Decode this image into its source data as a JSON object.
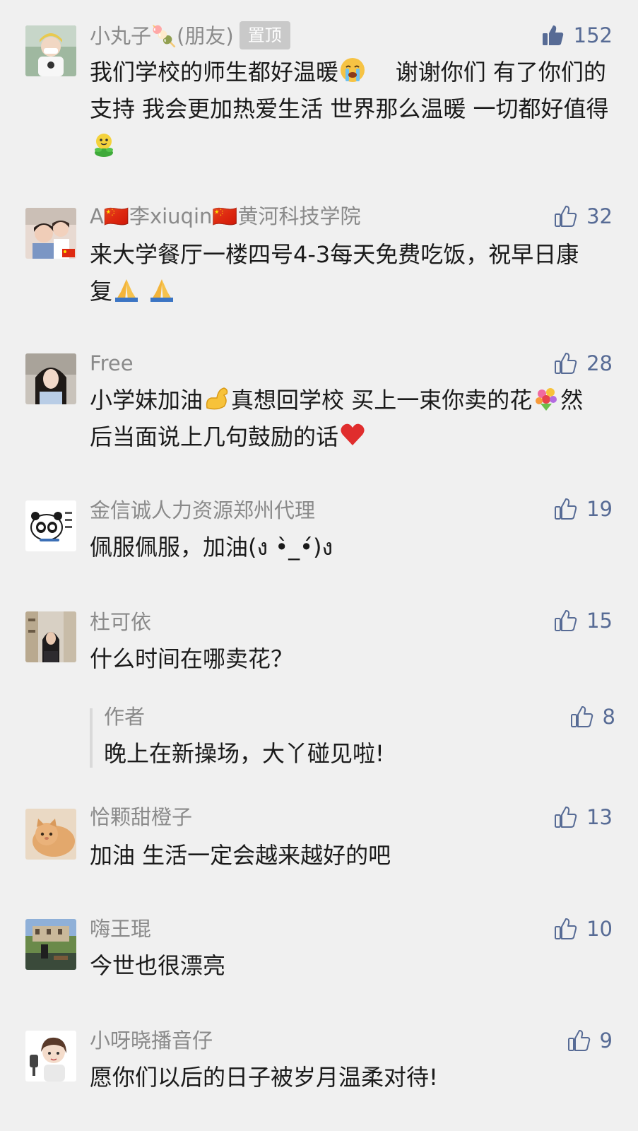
{
  "colors": {
    "background": "#f0f0f0",
    "name": "#8a8a8a",
    "text": "#1a1a1a",
    "like": "#576b95",
    "pin_badge": "#c9c9c9"
  },
  "comments": [
    {
      "name": "小丸子🍡(朋友)",
      "pin_label": "置顶",
      "likes": "152",
      "like_state": "filled",
      "text_parts": [
        "我们学校的师生都好温暖",
        "谢谢你们 有了你们的支持 我会更加热爱生活 世界那么温暖 一切都好值得"
      ],
      "emoji": [
        "crying-emoji",
        "sprout-emoji"
      ]
    },
    {
      "name": "A🇨🇳李xiuqin🇨🇳黄河科技学院",
      "likes": "32",
      "text": "来大学餐厅一楼四号4-3每天免费吃饭，祝早日康复",
      "emoji": [
        "pray-emoji",
        "pray-emoji"
      ]
    },
    {
      "name": "Free",
      "likes": "28",
      "text_parts": [
        "小学妹加油",
        "真想回学校 买上一束你卖的花",
        "然后当面说上几句鼓励的话"
      ],
      "emoji": [
        "flexed-biceps-emoji",
        "bouquet-emoji",
        "red-heart-emoji"
      ]
    },
    {
      "name": "金信诚人力资源郑州代理",
      "likes": "19",
      "text": "佩服佩服，加油(ง •̀_•́)ง"
    },
    {
      "name": "杜可依",
      "likes": "15",
      "text": "什么时间在哪卖花？",
      "reply": {
        "name": "作者",
        "likes": "8",
        "text": "晚上在新操场，大丫碰见啦!"
      }
    },
    {
      "name": "恰颗甜橙子",
      "likes": "13",
      "text": "加油 生活一定会越来越好的吧"
    },
    {
      "name": "嗨王琨",
      "likes": "10",
      "text": "今世也很漂亮"
    },
    {
      "name": "小呀晓播音仔",
      "likes": "9",
      "text": "愿你们以后的日子被岁月温柔对待!"
    }
  ]
}
